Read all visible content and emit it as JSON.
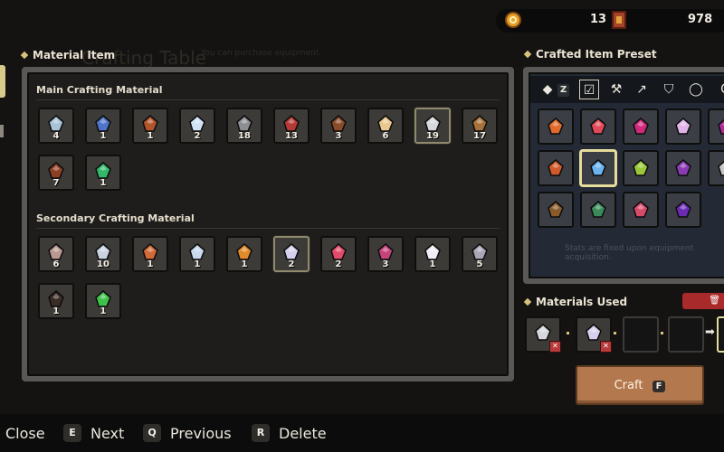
{
  "resources": {
    "coins": "13",
    "books": "978"
  },
  "ghost": {
    "title": "Crafting Table",
    "subtitle": "You can purchase equipment.",
    "stats_note": "Stats are fixed upon equipment acquisition."
  },
  "material_item": {
    "title": "Material Item",
    "main": {
      "heading": "Main Crafting Material",
      "items": [
        {
          "icon": "ore-chunk-icon",
          "count": "4",
          "color": "#a9c2d8"
        },
        {
          "icon": "blue-crystal-icon",
          "count": "1",
          "color": "#4f74c9"
        },
        {
          "icon": "leather-hide-icon",
          "count": "1",
          "color": "#b2542c"
        },
        {
          "icon": "diamond-icon",
          "count": "2",
          "color": "#cfe3f4"
        },
        {
          "icon": "iron-ore-icon",
          "count": "18",
          "color": "#8c8e92"
        },
        {
          "icon": "red-log-icon",
          "count": "13",
          "color": "#b43a36"
        },
        {
          "icon": "brown-fur-icon",
          "count": "3",
          "color": "#8a4b2a"
        },
        {
          "icon": "pearl-icon",
          "count": "6",
          "color": "#e8c88e"
        },
        {
          "icon": "silver-ore-icon",
          "count": "19",
          "color": "#d6d8dc",
          "selected": true
        },
        {
          "icon": "wood-log-icon",
          "count": "17",
          "color": "#a77239"
        },
        {
          "icon": "dark-hide-icon",
          "count": "7",
          "color": "#8c3f22"
        },
        {
          "icon": "emerald-icon",
          "count": "1",
          "color": "#33b86a"
        }
      ]
    },
    "secondary": {
      "heading": "Secondary Crafting Material",
      "items": [
        {
          "icon": "stone-flake-icon",
          "count": "6",
          "color": "#b89890"
        },
        {
          "icon": "silver-shard-icon",
          "count": "10",
          "color": "#c9d3e0"
        },
        {
          "icon": "hourglass-icon",
          "count": "1",
          "color": "#d06a3a"
        },
        {
          "icon": "magnifier-icon",
          "count": "1",
          "color": "#c8d9ec"
        },
        {
          "icon": "ankh-icon",
          "count": "1",
          "color": "#e08a2a"
        },
        {
          "icon": "prism-crystal-icon",
          "count": "2",
          "color": "#d8cfee",
          "selected": true
        },
        {
          "icon": "red-crystal-icon",
          "count": "2",
          "color": "#e24a6a"
        },
        {
          "icon": "hook-icon",
          "count": "3",
          "color": "#c4447a"
        },
        {
          "icon": "feather-icon",
          "count": "1",
          "color": "#f0eef4"
        },
        {
          "icon": "tablet-icon",
          "count": "5",
          "color": "#a9a7b4"
        },
        {
          "icon": "black-hat-icon",
          "count": "1",
          "color": "#3a2c26"
        },
        {
          "icon": "green-crystal-icon",
          "count": "1",
          "color": "#3fc24a"
        }
      ]
    }
  },
  "preset": {
    "title": "Crafted Item Preset",
    "tabs": [
      {
        "icon": "back-arrow-icon",
        "glyph": "◆",
        "key": "Z"
      },
      {
        "icon": "checkbox-icon",
        "glyph": "☑",
        "active": true
      },
      {
        "icon": "pickaxe-icon",
        "glyph": "⚒"
      },
      {
        "icon": "staff-icon",
        "glyph": "↗"
      },
      {
        "icon": "shield-icon",
        "glyph": "⛉"
      },
      {
        "icon": "ring-icon",
        "glyph": "◯"
      },
      {
        "icon": "c-key-icon",
        "glyph": "C"
      }
    ],
    "items": [
      {
        "icon": "flame-sword-icon",
        "color": "#e06a2a"
      },
      {
        "icon": "crossbow-icon",
        "color": "#e04a5a"
      },
      {
        "icon": "magenta-wand-icon",
        "color": "#d02a7a"
      },
      {
        "icon": "orb-staff-icon",
        "color": "#e0b4e8"
      },
      {
        "icon": "purple-blade-icon",
        "color": "#b42a9a"
      },
      {
        "icon": "fire-axe-icon",
        "color": "#d05a2a"
      },
      {
        "icon": "ice-sword-icon",
        "color": "#6ab4f0",
        "selected": true
      },
      {
        "icon": "green-lantern-icon",
        "color": "#9ac83a"
      },
      {
        "icon": "shadow-staff-icon",
        "color": "#8a3ab4"
      },
      {
        "icon": "net-icon",
        "color": "#c8c8c8"
      },
      {
        "icon": "gauntlet-icon",
        "color": "#8a5a2a"
      },
      {
        "icon": "green-helmet-icon",
        "color": "#3a8a5a"
      },
      {
        "icon": "pink-chain-icon",
        "color": "#d84a6a"
      },
      {
        "icon": "dark-amulet-icon",
        "color": "#6a2ab4"
      }
    ]
  },
  "materials_used": {
    "title": "Materials Used",
    "delete_glyph": "🗑",
    "slots": [
      {
        "icon": "silver-ore-icon",
        "color": "#d6d8dc",
        "remove": "✕"
      },
      {
        "icon": "prism-crystal-icon",
        "color": "#d8cfee",
        "remove": "✕"
      },
      {
        "icon": "empty-slot-icon"
      },
      {
        "icon": "empty-slot-icon"
      }
    ],
    "arrow": "➡"
  },
  "craft": {
    "label": "Craft",
    "key": "F"
  },
  "bottom_bar": {
    "close": "Close",
    "next_key": "E",
    "next": "Next",
    "prev_key": "Q",
    "prev": "Previous",
    "del_key": "R",
    "del": "Delete"
  }
}
